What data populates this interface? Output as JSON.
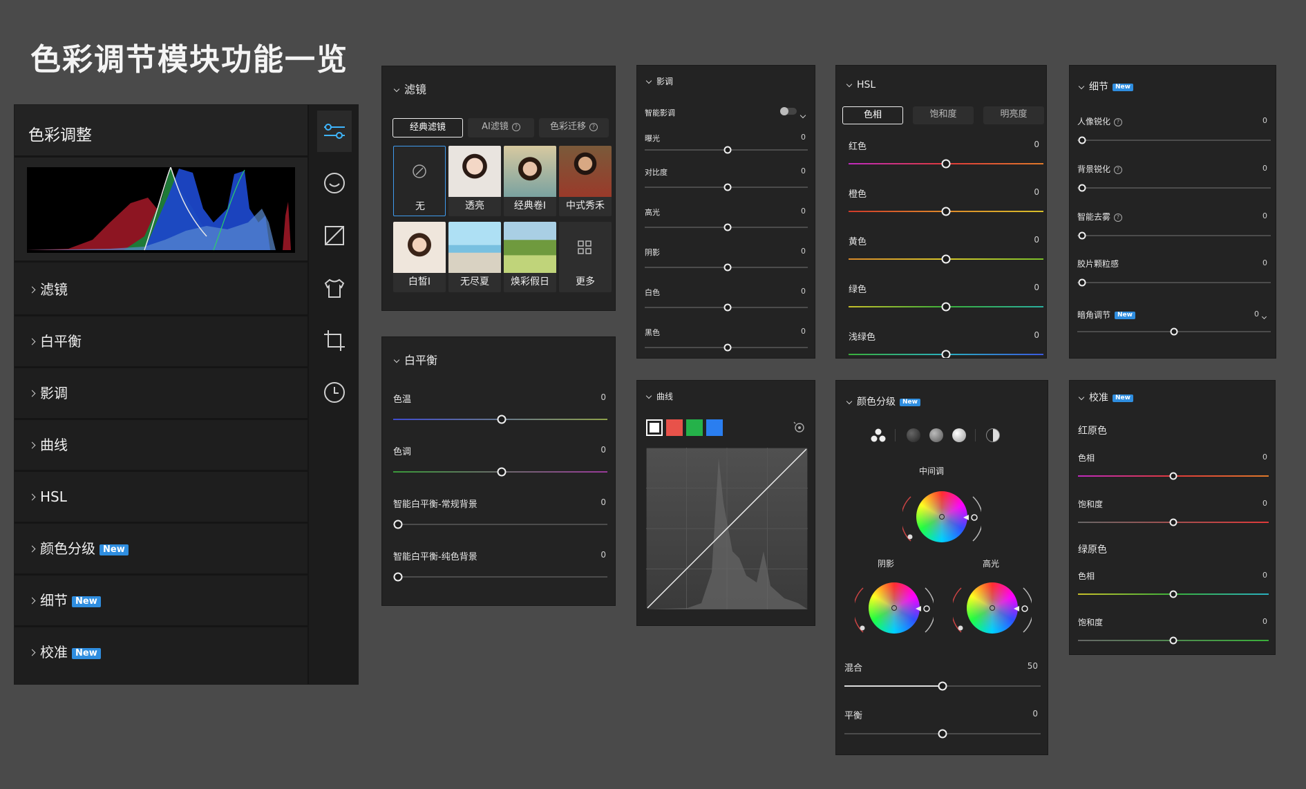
{
  "page_title": "色彩调节模块功能一览",
  "sidebar": {
    "title": "色彩调整",
    "items": [
      {
        "label": "滤镜",
        "badge": ""
      },
      {
        "label": "白平衡",
        "badge": ""
      },
      {
        "label": "影调",
        "badge": ""
      },
      {
        "label": "曲线",
        "badge": ""
      },
      {
        "label": "HSL",
        "badge": ""
      },
      {
        "label": "颜色分级",
        "badge": "New"
      },
      {
        "label": "细节",
        "badge": "New"
      },
      {
        "label": "校准",
        "badge": "New"
      }
    ],
    "tool_icons": [
      "sliders-icon",
      "face-icon",
      "exposure-icon",
      "shirt-icon",
      "crop-icon",
      "history-icon"
    ]
  },
  "filter": {
    "title": "滤镜",
    "tabs": [
      "经典滤镜",
      "AI滤镜",
      "色彩迁移"
    ],
    "items": [
      "无",
      "透亮",
      "经典卷I",
      "中式秀禾",
      "白皙I",
      "无尽夏",
      "焕彩假日",
      "更多"
    ]
  },
  "white_balance": {
    "title": "白平衡",
    "sliders": [
      {
        "label": "色温",
        "value": "0",
        "pos": 0.5
      },
      {
        "label": "色调",
        "value": "0",
        "pos": 0.5
      },
      {
        "label": "智能白平衡-常规背景",
        "value": "0",
        "pos": 0
      },
      {
        "label": "智能白平衡-纯色背景",
        "value": "0",
        "pos": 0
      }
    ]
  },
  "tone": {
    "title": "影调",
    "smart_label": "智能影调",
    "sliders": [
      {
        "label": "曝光",
        "value": "0",
        "pos": 0.5
      },
      {
        "label": "对比度",
        "value": "0",
        "pos": 0.5
      },
      {
        "label": "高光",
        "value": "0",
        "pos": 0.5
      },
      {
        "label": "阴影",
        "value": "0",
        "pos": 0.5
      },
      {
        "label": "白色",
        "value": "0",
        "pos": 0.5
      },
      {
        "label": "黑色",
        "value": "0",
        "pos": 0.5
      }
    ]
  },
  "curve": {
    "title": "曲线",
    "channels": [
      "white",
      "red",
      "green",
      "blue"
    ]
  },
  "hsl": {
    "title": "HSL",
    "tabs": [
      "色相",
      "饱和度",
      "明亮度"
    ],
    "sliders": [
      {
        "label": "红色",
        "value": "0",
        "pos": 0.5
      },
      {
        "label": "橙色",
        "value": "0",
        "pos": 0.5
      },
      {
        "label": "黄色",
        "value": "0",
        "pos": 0.5
      },
      {
        "label": "绿色",
        "value": "0",
        "pos": 0.5
      },
      {
        "label": "浅绿色",
        "value": "0",
        "pos": 0.5
      }
    ]
  },
  "grading": {
    "title": "颜色分级",
    "badge": "New",
    "midtone_label": "中间调",
    "shadow_label": "阴影",
    "highlight_label": "高光",
    "sliders": [
      {
        "label": "混合",
        "value": "50",
        "pos": 0.5
      },
      {
        "label": "平衡",
        "value": "0",
        "pos": 0.5
      }
    ]
  },
  "detail": {
    "title": "细节",
    "badge": "New",
    "sliders": [
      {
        "label": "人像锐化",
        "value": "0",
        "pos": 0,
        "help": true
      },
      {
        "label": "背景锐化",
        "value": "0",
        "pos": 0,
        "help": true
      },
      {
        "label": "智能去雾",
        "value": "0",
        "pos": 0,
        "help": true
      },
      {
        "label": "胶片颗粒感",
        "value": "0",
        "pos": 0,
        "help": false
      }
    ],
    "vignette": {
      "label": "暗角调节",
      "badge": "New",
      "value": "0",
      "pos": 0.5
    }
  },
  "calibration": {
    "title": "校准",
    "badge": "New",
    "groups": [
      {
        "name": "红原色",
        "sliders": [
          {
            "label": "色相",
            "value": "0",
            "pos": 0.5
          },
          {
            "label": "饱和度",
            "value": "0",
            "pos": 0.5
          }
        ]
      },
      {
        "name": "绿原色",
        "sliders": [
          {
            "label": "色相",
            "value": "0",
            "pos": 0.5
          },
          {
            "label": "饱和度",
            "value": "0",
            "pos": 0.5
          }
        ]
      }
    ]
  },
  "colors": {
    "accent": "#2f8ee0",
    "panel": "#232323",
    "background": "#4a4a4a"
  }
}
